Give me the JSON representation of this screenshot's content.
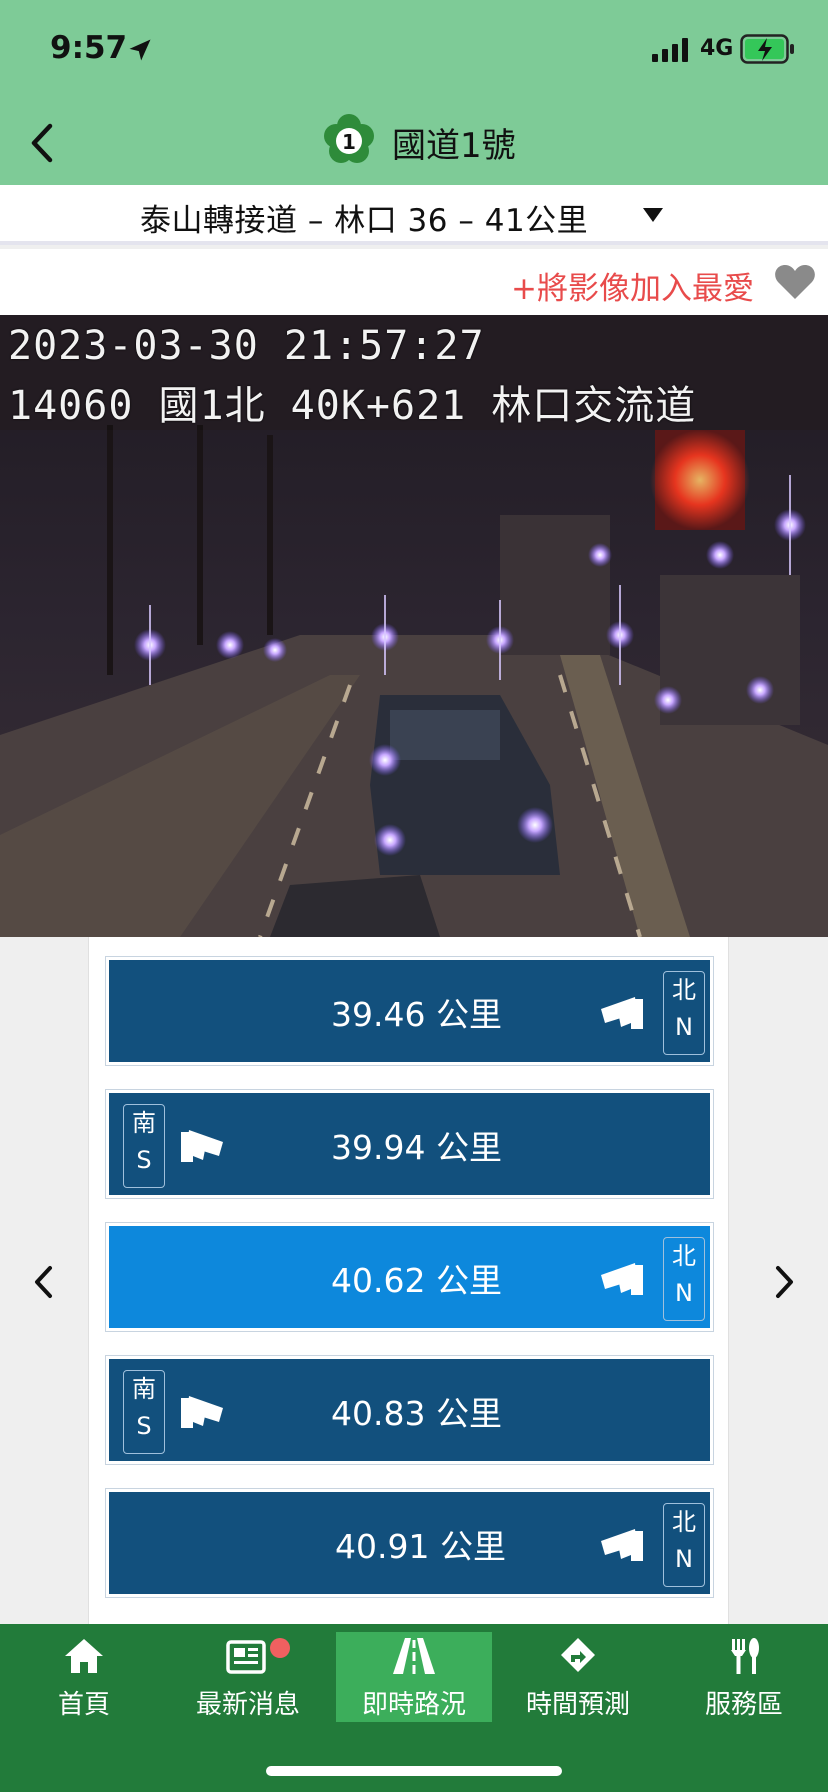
{
  "status_bar": {
    "time": "9:57",
    "network": "4G"
  },
  "nav": {
    "route_number": "1",
    "title": "國道1號"
  },
  "section": {
    "title": "泰山轉接道 – 林口 36 – 41公里"
  },
  "favorite": {
    "label": "+將影像加入最愛"
  },
  "camera": {
    "timestamp": "2023-03-30 21:57:27",
    "location": "14060 國1北 40K+621 林口交流道"
  },
  "cameras": [
    {
      "km": "39.46 公里",
      "dir_char": "北",
      "dir_letter": "N"
    },
    {
      "km": "39.94 公里",
      "dir_char": "南",
      "dir_letter": "S"
    },
    {
      "km": "40.62 公里",
      "dir_char": "北",
      "dir_letter": "N"
    },
    {
      "km": "40.83 公里",
      "dir_char": "南",
      "dir_letter": "S"
    },
    {
      "km": "40.91 公里",
      "dir_char": "北",
      "dir_letter": "N"
    }
  ],
  "tabs": [
    {
      "label": "首頁",
      "icon": "home-icon"
    },
    {
      "label": "最新消息",
      "icon": "news-icon"
    },
    {
      "label": "即時路況",
      "icon": "road-icon"
    },
    {
      "label": "時間預測",
      "icon": "direction-icon"
    },
    {
      "label": "服務區",
      "icon": "utensils-icon"
    }
  ],
  "colors": {
    "header_green": "#7ecb97",
    "tab_bar_green": "#227b3a",
    "tab_active": "#3cae5b",
    "item_blue": "#12507d",
    "item_active_blue": "#0d88dc",
    "favorite_red": "#e84b4b"
  }
}
